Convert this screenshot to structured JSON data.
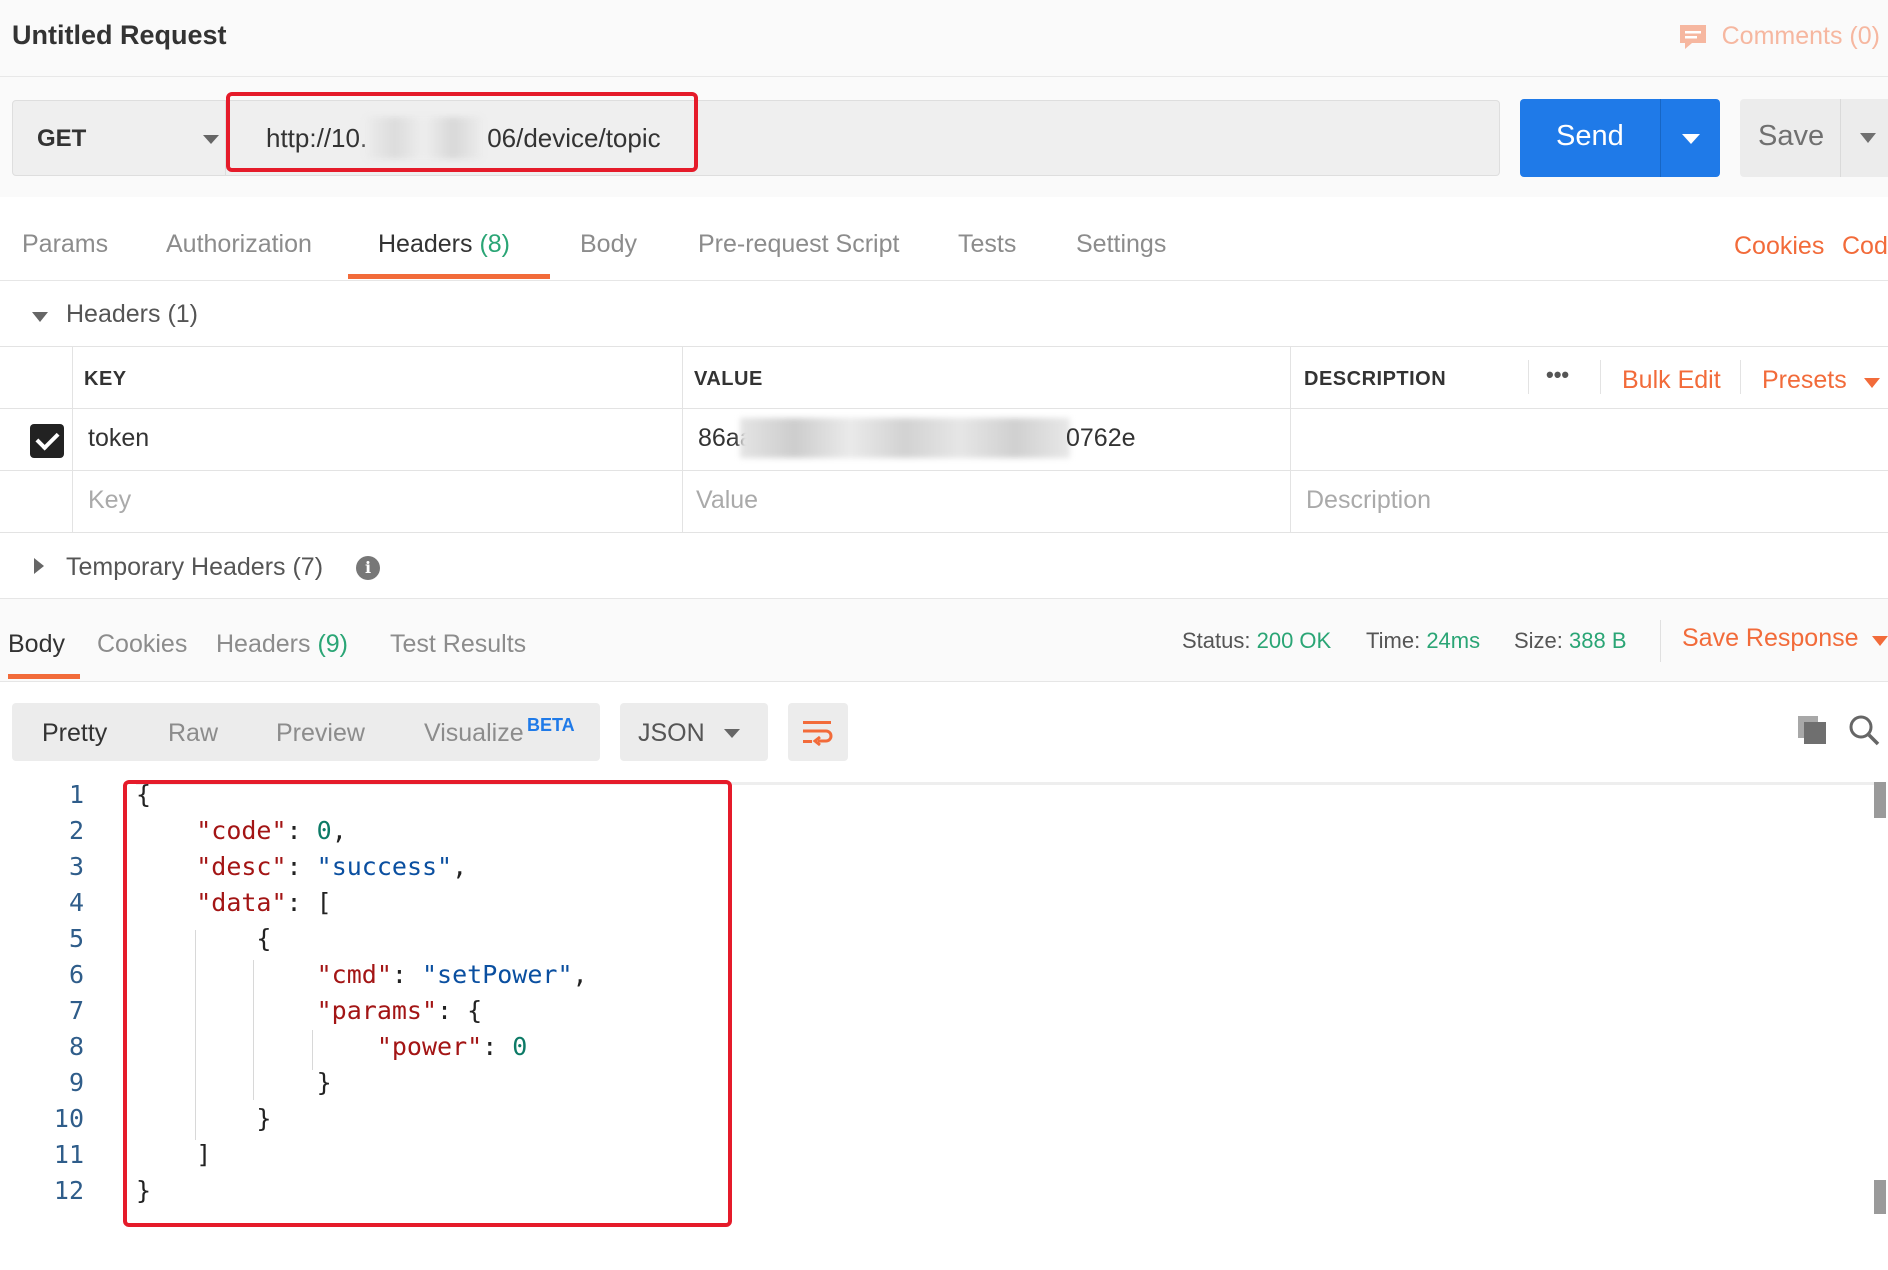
{
  "window": {
    "title": "Untitled Request",
    "comments_label": "Comments (0)"
  },
  "request": {
    "method": "GET",
    "url_visible": "http://10.",
    "url_suffix": "06/device/topic",
    "send_label": "Send",
    "save_label": "Save"
  },
  "request_tabs": [
    {
      "label": "Params"
    },
    {
      "label": "Authorization"
    },
    {
      "label": "Headers",
      "count": "(8)",
      "active": true
    },
    {
      "label": "Body"
    },
    {
      "label": "Pre-request Script"
    },
    {
      "label": "Tests"
    },
    {
      "label": "Settings"
    }
  ],
  "request_links": {
    "cookies": "Cookies",
    "code": "Cod"
  },
  "headers_section": {
    "title": "Headers",
    "count": "(1)",
    "columns": {
      "key": "KEY",
      "value": "VALUE",
      "description": "DESCRIPTION"
    },
    "more_label": "•••",
    "bulk_edit": "Bulk Edit",
    "presets": "Presets",
    "rows": [
      {
        "checked": true,
        "key": "token",
        "value_prefix": "86aa",
        "value_suffix": "0762e",
        "description": ""
      }
    ],
    "placeholder": {
      "key": "Key",
      "value": "Value",
      "description": "Description"
    }
  },
  "temporary_headers": {
    "title": "Temporary Headers",
    "count": "(7)",
    "info": "i"
  },
  "response_tabs": [
    {
      "label": "Body",
      "active": true
    },
    {
      "label": "Cookies"
    },
    {
      "label": "Headers",
      "count": "(9)"
    },
    {
      "label": "Test Results"
    }
  ],
  "response_meta": {
    "status_label": "Status:",
    "status_value": "200 OK",
    "time_label": "Time:",
    "time_value": "24ms",
    "size_label": "Size:",
    "size_value": "388 B",
    "save_response": "Save Response"
  },
  "format_bar": {
    "modes": [
      "Pretty",
      "Raw",
      "Preview",
      "Visualize"
    ],
    "beta": "BETA",
    "language": "JSON"
  },
  "icons": {
    "comments": "comment-icon",
    "wrap": "wrap-lines-icon",
    "copy": "copy-icon",
    "search": "search-icon",
    "info": "info-icon"
  },
  "colors": {
    "accent": "#f26b3a",
    "send": "#1f7ae8",
    "success": "#2aa575",
    "highlight": "#e51b2a"
  },
  "code": {
    "line_numbers": [
      "1",
      "2",
      "3",
      "4",
      "5",
      "6",
      "7",
      "8",
      "9",
      "10",
      "11",
      "12"
    ],
    "lines": [
      {
        "indent": "",
        "parts": [
          [
            "p",
            "{"
          ]
        ]
      },
      {
        "indent": "    ",
        "parts": [
          [
            "k",
            "\"code\""
          ],
          [
            "p",
            ": "
          ],
          [
            "n",
            "0"
          ],
          [
            "p",
            ","
          ]
        ]
      },
      {
        "indent": "    ",
        "parts": [
          [
            "k",
            "\"desc\""
          ],
          [
            "p",
            ": "
          ],
          [
            "s",
            "\"success\""
          ],
          [
            "p",
            ","
          ]
        ]
      },
      {
        "indent": "    ",
        "parts": [
          [
            "k",
            "\"data\""
          ],
          [
            "p",
            ": ["
          ]
        ]
      },
      {
        "indent": "        ",
        "parts": [
          [
            "p",
            "{"
          ]
        ]
      },
      {
        "indent": "            ",
        "parts": [
          [
            "k",
            "\"cmd\""
          ],
          [
            "p",
            ": "
          ],
          [
            "s",
            "\"setPower\""
          ],
          [
            "p",
            ","
          ]
        ]
      },
      {
        "indent": "            ",
        "parts": [
          [
            "k",
            "\"params\""
          ],
          [
            "p",
            ": {"
          ]
        ]
      },
      {
        "indent": "                ",
        "parts": [
          [
            "k",
            "\"power\""
          ],
          [
            "p",
            ": "
          ],
          [
            "n",
            "0"
          ]
        ]
      },
      {
        "indent": "            ",
        "parts": [
          [
            "p",
            "}"
          ]
        ]
      },
      {
        "indent": "        ",
        "parts": [
          [
            "p",
            "}"
          ]
        ]
      },
      {
        "indent": "    ",
        "parts": [
          [
            "p",
            "]"
          ]
        ]
      },
      {
        "indent": "",
        "parts": [
          [
            "p",
            "}"
          ]
        ]
      }
    ]
  }
}
